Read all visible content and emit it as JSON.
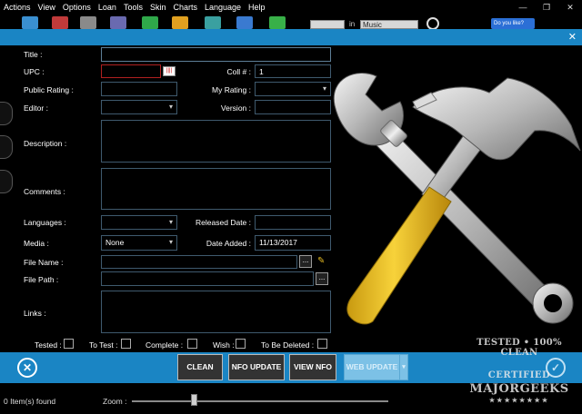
{
  "menu": [
    "Actions",
    "View",
    "Options",
    "Loan",
    "Tools",
    "Skin",
    "Charts",
    "Language",
    "Help"
  ],
  "window": {
    "min": "—",
    "restore": "❐",
    "close": "✕"
  },
  "toolbar": {
    "in_label": "in",
    "category_value": "Music",
    "like_label": "Do you like?"
  },
  "dialog": {
    "close": "✕"
  },
  "form": {
    "title_label": "Title :",
    "upc_label": "UPC :",
    "coll_label": "Coll # :",
    "coll_value": "1",
    "public_rating_label": "Public Rating :",
    "my_rating_label": "My Rating :",
    "editor_label": "Editor :",
    "version_label": "Version :",
    "description_label": "Description :",
    "comments_label": "Comments :",
    "languages_label": "Languages :",
    "released_label": "Released Date :",
    "media_label": "Media :",
    "media_value": "None",
    "date_added_label": "Date Added :",
    "date_added_value": "11/13/2017",
    "file_name_label": "File Name :",
    "file_path_label": "File Path :",
    "links_label": "Links :",
    "browse_label": "...",
    "checks": {
      "tested": "Tested :",
      "to_test": "To Test :",
      "complete": "Complete :",
      "wish": "Wish :",
      "to_be_deleted": "To Be Deleted :"
    }
  },
  "actions": {
    "cancel": "✕",
    "clean": "CLEAN",
    "nfo_update": "NFO UPDATE",
    "view_nfo": "VIEW NFO",
    "web_update": "WEB UPDATE",
    "ok": "✓"
  },
  "status": {
    "items_found": "0 Item(s) found",
    "zoom_label": "Zoom :",
    "zoom_level": 0.24
  },
  "watermark": {
    "line1": "TESTED • 100% CLEAN",
    "line2": "CERTIFIED",
    "line3": "MAJORGEEKS",
    "stars": "★★★★★★★★"
  },
  "colors": {
    "accent": "#1a85c4",
    "field_border": "#3f5a6e",
    "handle_yellow": "#f2c21b"
  }
}
